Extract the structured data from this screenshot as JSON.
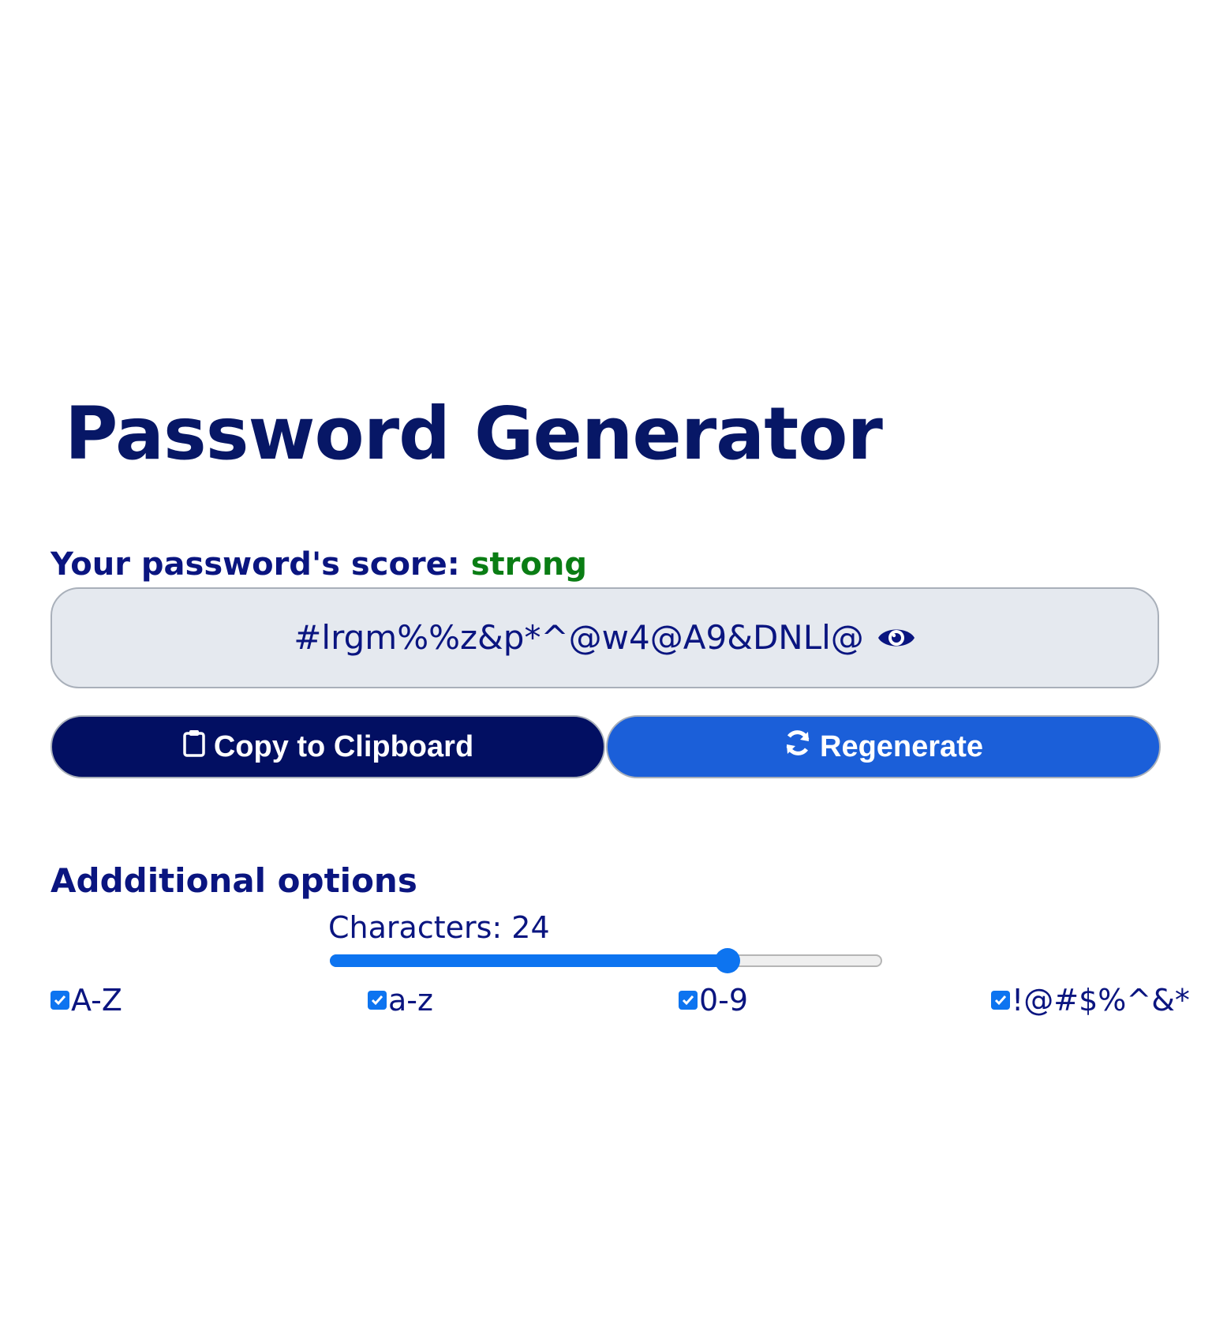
{
  "page": {
    "title": "Password Generator"
  },
  "score": {
    "label": "Your password's score: ",
    "value": "strong",
    "value_color": "#0a7d14"
  },
  "password": {
    "value": "#lrgm%%z&p*^@w4@A9&DNLl@",
    "toggle_icon": "eye-icon"
  },
  "actions": {
    "copy_label": "Copy to Clipboard",
    "copy_icon": "clipboard-icon",
    "regenerate_label": "Regenerate",
    "regenerate_icon": "refresh-icon"
  },
  "options": {
    "title": "Addditional options",
    "characters_label": "Characters: 24",
    "length_slider_fraction": 0.72,
    "charsets": [
      {
        "label": "A-Z",
        "checked": true
      },
      {
        "label": "a-z",
        "checked": true
      },
      {
        "label": "0-9",
        "checked": true
      },
      {
        "label": "!@#$%^&*",
        "checked": true
      }
    ]
  },
  "colors": {
    "heading": "#071766",
    "text": "#0a1580",
    "copy_button": "#020f62",
    "regenerate_button": "#1b5fd9",
    "accent": "#0d74f0",
    "password_box": "#e5e9ef"
  }
}
